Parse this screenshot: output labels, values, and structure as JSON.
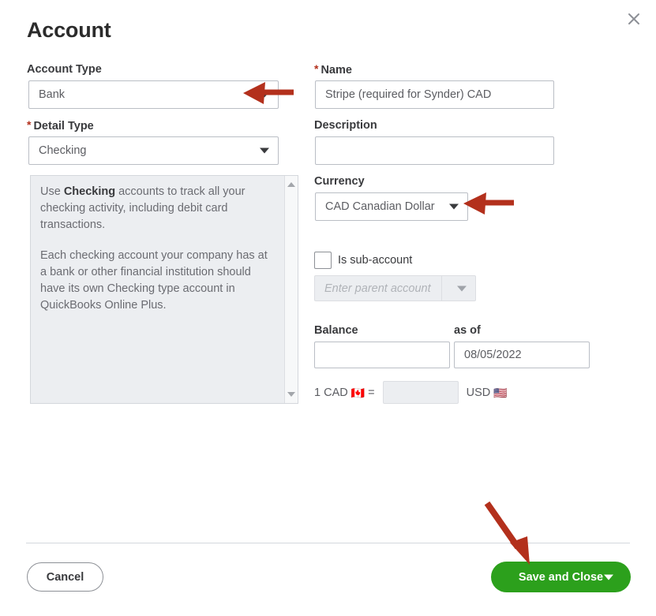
{
  "dialog": {
    "title": "Account",
    "close_icon": "close-icon"
  },
  "left_column": {
    "account_type": {
      "label": "Account Type",
      "value": "Bank",
      "required": false
    },
    "detail_type": {
      "label": "Detail Type",
      "value": "Checking",
      "required": true,
      "required_marker": "*"
    },
    "help_panel": {
      "paragraph_1_prefix": "Use ",
      "paragraph_1_bold": "Checking",
      "paragraph_1_suffix": " accounts to track all your checking activity, including debit card transactions.",
      "paragraph_2": "Each checking account your company has at a bank or other financial institution should have its own Checking type account in QuickBooks Online Plus.",
      "scroll_up_icon": "scroll-up-arrow-icon",
      "scroll_down_icon": "scroll-down-arrow-icon"
    }
  },
  "right_column": {
    "name": {
      "label": "Name",
      "value": "Stripe (required for Synder) CAD",
      "required": true,
      "required_marker": "*"
    },
    "description": {
      "label": "Description",
      "value": "",
      "placeholder": ""
    },
    "currency": {
      "label": "Currency",
      "value": "CAD Canadian Dollar"
    },
    "sub_account": {
      "label": "Is sub-account",
      "checked": false,
      "parent_placeholder": "Enter parent account",
      "parent_value": "",
      "disabled": true
    },
    "balance": {
      "label": "Balance",
      "value": ""
    },
    "as_of": {
      "label": "as of",
      "value": "08/05/2022"
    },
    "exchange_rate": {
      "prefix": "1 CAD",
      "from_flag": "🇨🇦",
      "equals": "=",
      "rate_value": "",
      "suffix": "USD",
      "to_flag": "🇺🇸"
    }
  },
  "footer": {
    "cancel_label": "Cancel",
    "save_label": "Save and Close",
    "save_dropdown_icon": "chevron-down-icon"
  },
  "annotations": {
    "accent_color": "#b3301c",
    "arrows": [
      {
        "name": "arrow-to-account-type",
        "direction": "left",
        "target": "Account Type dropdown"
      },
      {
        "name": "arrow-to-currency",
        "direction": "left",
        "target": "Currency dropdown"
      },
      {
        "name": "arrow-to-save-and-close",
        "direction": "down-right",
        "target": "Save and Close button"
      }
    ]
  }
}
